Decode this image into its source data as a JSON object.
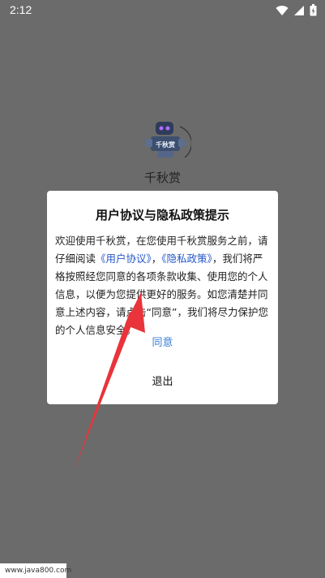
{
  "status_bar": {
    "time": "2:12"
  },
  "app": {
    "name": "千秋赏",
    "logo_text": "千秋赏"
  },
  "dialog": {
    "title": "用户协议与隐私政策提示",
    "body_1": "欢迎使用千秋赏，在您使用千秋赏服务之前，请仔细阅读",
    "link_user_agreement": "《用户协议》",
    "body_2": "，",
    "link_privacy_policy": "《隐私政策》",
    "body_3": "，我们将严格按照经您同意的各项条款收集、使用您的个人信息，以便为您提供更好的服务。如您清楚并同意上述内容，请点击“同意”，我们将尽力保护您的个人信息安全。",
    "agree_label": "同意",
    "exit_label": "退出"
  },
  "watermark": "www.java800.com",
  "colors": {
    "overlay": "#6b6b6b",
    "link": "#2457c9",
    "agree": "#3b7fd4",
    "arrow": "#e8343a"
  }
}
